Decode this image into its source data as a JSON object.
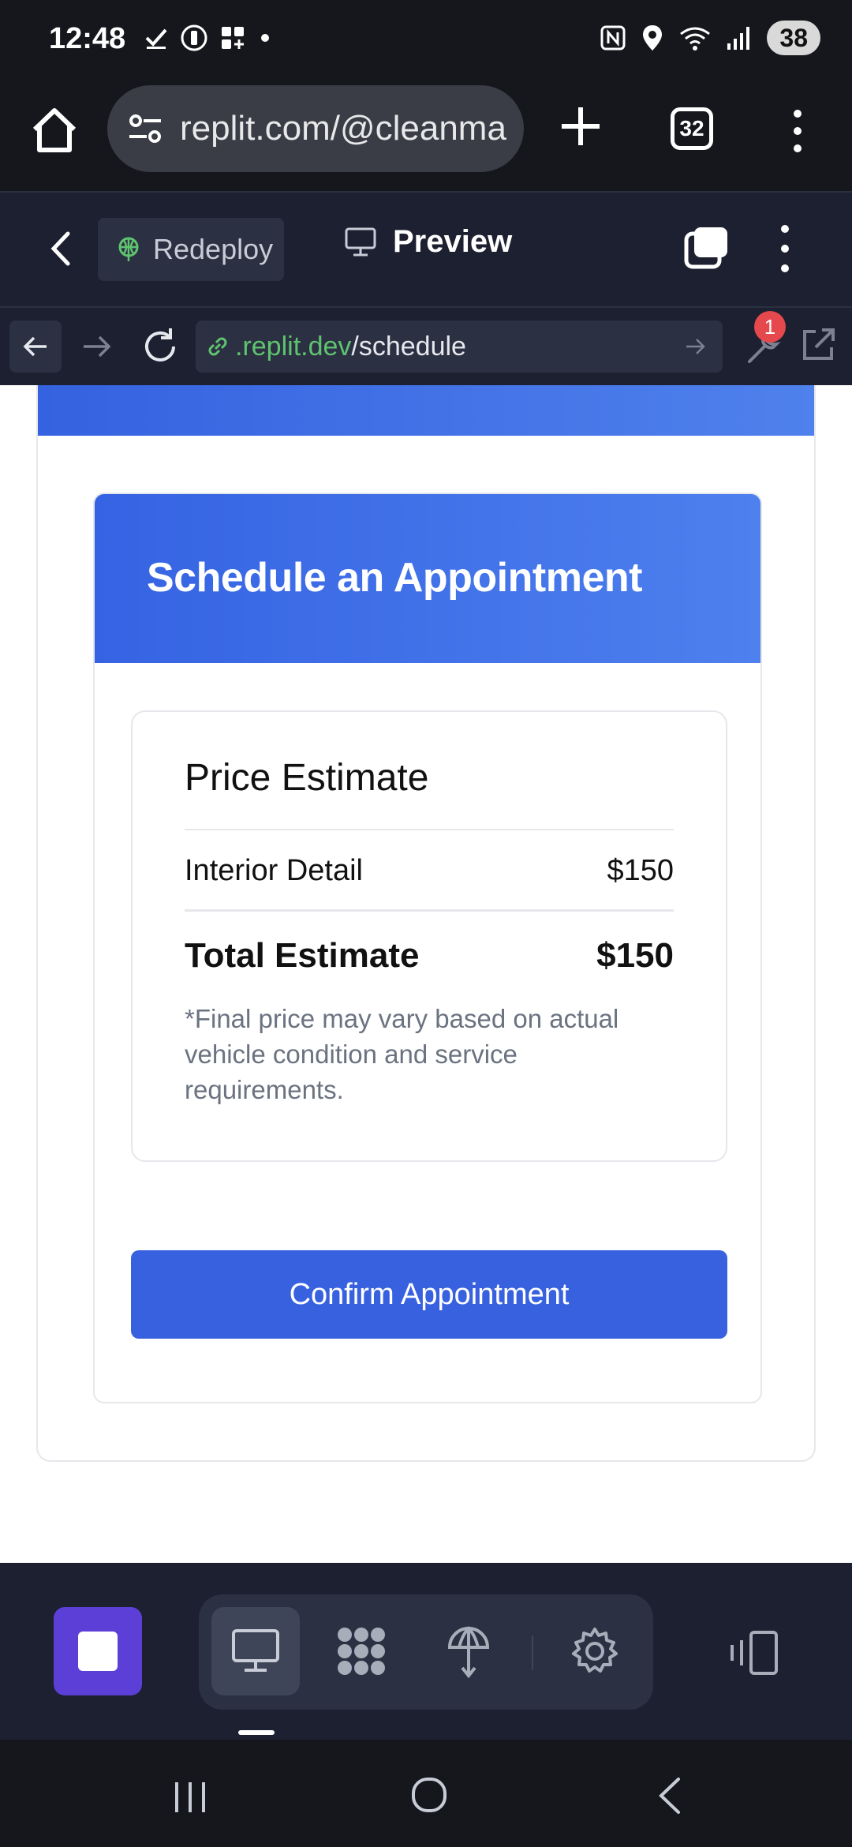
{
  "status_bar": {
    "time": "12:48",
    "battery": "38"
  },
  "browser": {
    "url_text": "replit.com/@cleanma",
    "tab_count": "32"
  },
  "replit_toolbar": {
    "redeploy_label": "Redeploy",
    "preview_label": "Preview"
  },
  "address_bar": {
    "domain": ".replit.dev",
    "path": "/schedule",
    "tools_badge": "1"
  },
  "page": {
    "heading": "Schedule an Appointment",
    "price_estimate": {
      "title": "Price Estimate",
      "items": [
        {
          "label": "Interior Detail",
          "price": "$150"
        }
      ],
      "total_label": "Total Estimate",
      "total_value": "$150",
      "note": "*Final price may vary based on actual vehicle condition and service requirements."
    },
    "confirm_label": "Confirm Appointment"
  },
  "colors": {
    "accent": "#3861e0",
    "header_gradient_start": "#3563e3",
    "header_gradient_end": "#4e80ee",
    "stop_button": "#5b3fd6",
    "badge": "#e5484d"
  }
}
